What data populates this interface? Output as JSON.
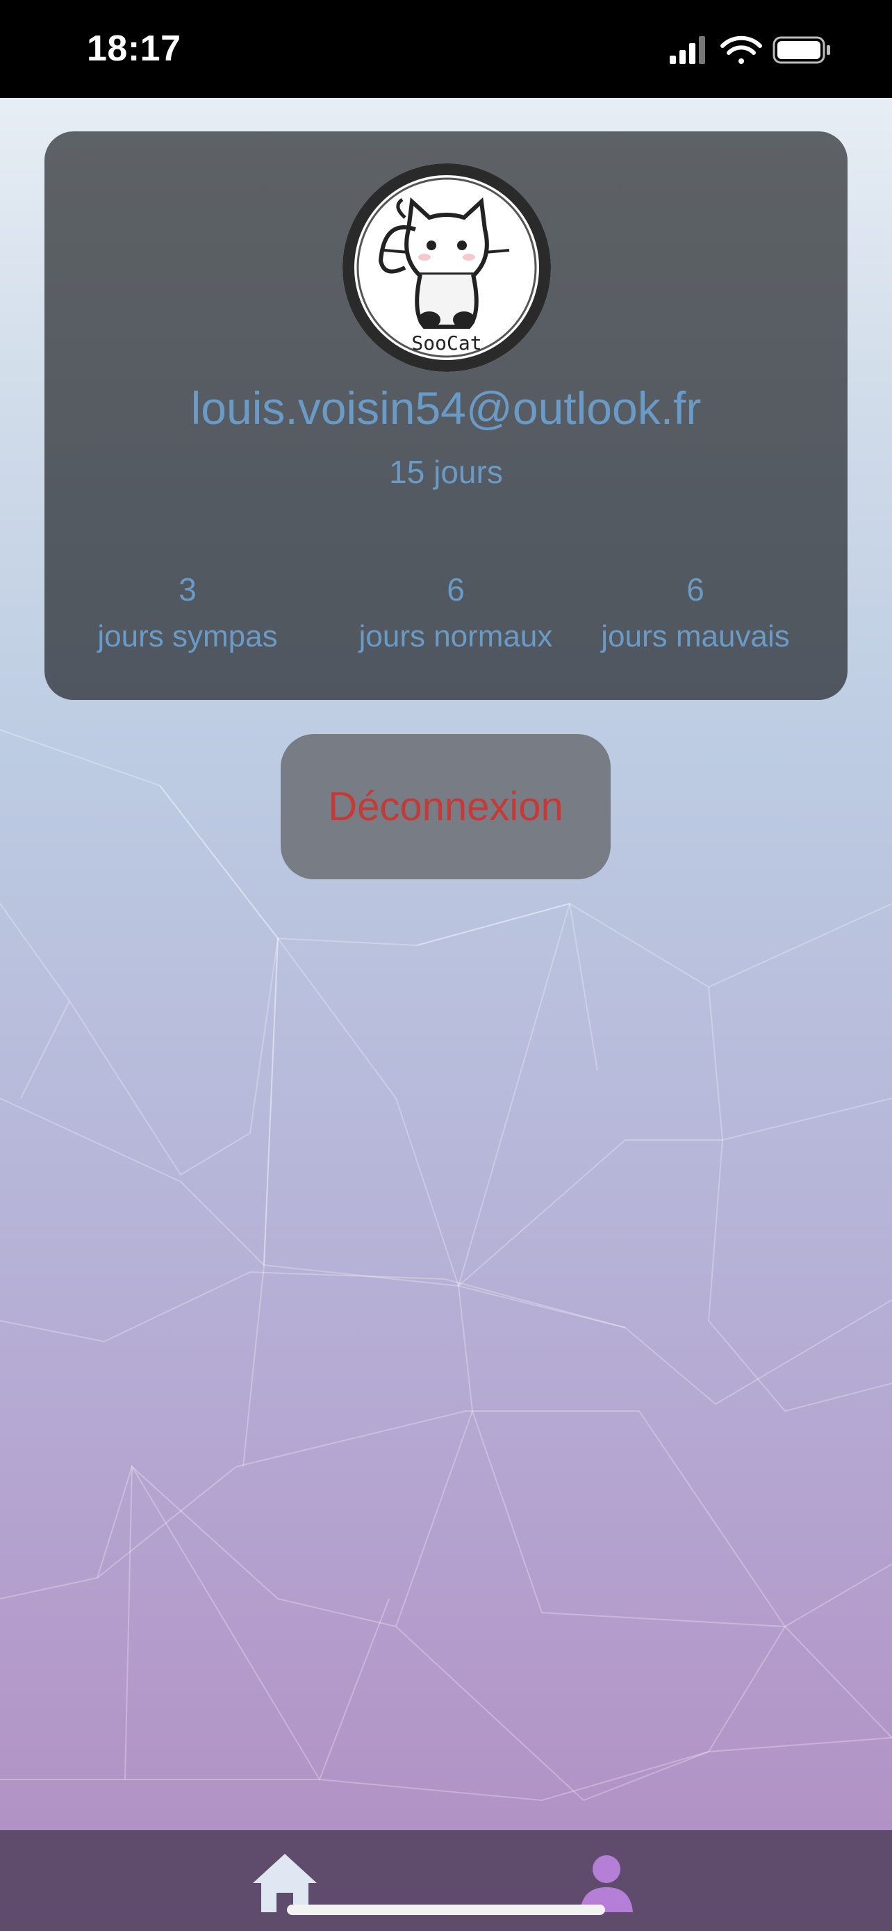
{
  "status_bar": {
    "time": "18:17",
    "icons": [
      "signal-icon",
      "wifi-icon",
      "battery-icon"
    ]
  },
  "profile": {
    "avatar_text": "SooCat",
    "email": "louis.voisin54@outlook.fr",
    "days": "15 jours",
    "stats": [
      {
        "value": "3",
        "label": "jours sympas"
      },
      {
        "value": "6",
        "label": "jours normaux"
      },
      {
        "value": "6",
        "label": "jours mauvais"
      }
    ]
  },
  "logout": {
    "label": "Déconnexion"
  },
  "tab_bar": {
    "tabs": [
      {
        "icon": "home-icon",
        "active": false
      },
      {
        "icon": "person-icon",
        "active": true
      }
    ]
  },
  "colors": {
    "accent_text": "#6a9bc6",
    "logout_text": "#c53a36",
    "active_tab": "#b57fd8",
    "inactive_tab": "#dfe7f2"
  }
}
